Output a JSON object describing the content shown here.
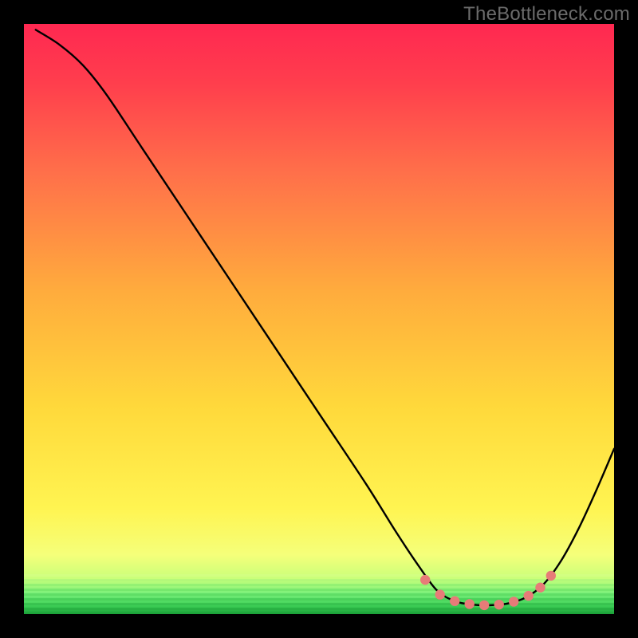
{
  "watermark": "TheBottleneck.com",
  "colors": {
    "top": "#ff2851",
    "mid": "#ffe63a",
    "green_band": "#41e05b",
    "green_deep": "#1aa038",
    "dot": "#e77b78",
    "curve": "#000000",
    "frame": "#000000",
    "wm": "#6b6b6b"
  },
  "chart_data": {
    "type": "line",
    "title": "",
    "xlabel": "",
    "ylabel": "",
    "xlim": [
      0,
      100
    ],
    "ylim": [
      0,
      100
    ],
    "grid": false,
    "legend": false,
    "curve_points": [
      {
        "x": 2,
        "y": 99
      },
      {
        "x": 6,
        "y": 96.5
      },
      {
        "x": 10,
        "y": 93
      },
      {
        "x": 14,
        "y": 88
      },
      {
        "x": 20,
        "y": 79
      },
      {
        "x": 30,
        "y": 64
      },
      {
        "x": 40,
        "y": 49
      },
      {
        "x": 50,
        "y": 34
      },
      {
        "x": 58,
        "y": 22
      },
      {
        "x": 63,
        "y": 14
      },
      {
        "x": 67,
        "y": 8
      },
      {
        "x": 70,
        "y": 4
      },
      {
        "x": 73,
        "y": 2.2
      },
      {
        "x": 76,
        "y": 1.6
      },
      {
        "x": 79,
        "y": 1.5
      },
      {
        "x": 82,
        "y": 1.8
      },
      {
        "x": 85,
        "y": 2.8
      },
      {
        "x": 88,
        "y": 5
      },
      {
        "x": 91,
        "y": 9
      },
      {
        "x": 94,
        "y": 14.5
      },
      {
        "x": 97,
        "y": 21
      },
      {
        "x": 100,
        "y": 28
      }
    ],
    "valley_dots": [
      {
        "x": 68,
        "y": 5.8
      },
      {
        "x": 70.5,
        "y": 3.3
      },
      {
        "x": 73,
        "y": 2.2
      },
      {
        "x": 75.5,
        "y": 1.7
      },
      {
        "x": 78,
        "y": 1.5
      },
      {
        "x": 80.5,
        "y": 1.6
      },
      {
        "x": 83,
        "y": 2.1
      },
      {
        "x": 85.5,
        "y": 3.1
      },
      {
        "x": 87.5,
        "y": 4.5
      },
      {
        "x": 89.3,
        "y": 6.5
      }
    ]
  }
}
